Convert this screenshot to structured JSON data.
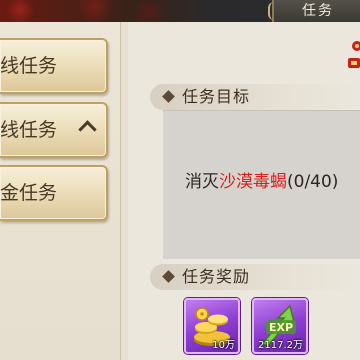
{
  "window": {
    "title": "任务"
  },
  "sidebar": {
    "tabs": [
      {
        "label": "线任务",
        "expanded": false
      },
      {
        "label": "线任务",
        "expanded": true,
        "chevron": "chevron-up-icon"
      },
      {
        "label": "金任务",
        "expanded": false
      }
    ]
  },
  "objective": {
    "header": "任务目标",
    "verb": "消灭",
    "target": "沙漠毒蝎",
    "progress": "(0/40)"
  },
  "rewards": {
    "header": "任务奖励",
    "items": [
      {
        "icon": "gold-coins-icon",
        "qty": "10万"
      },
      {
        "icon": "exp-icon",
        "qty": "2117.2万"
      }
    ]
  },
  "colors": {
    "target_text": "#d8201a",
    "reward_rarity": "#8e3fd3"
  }
}
